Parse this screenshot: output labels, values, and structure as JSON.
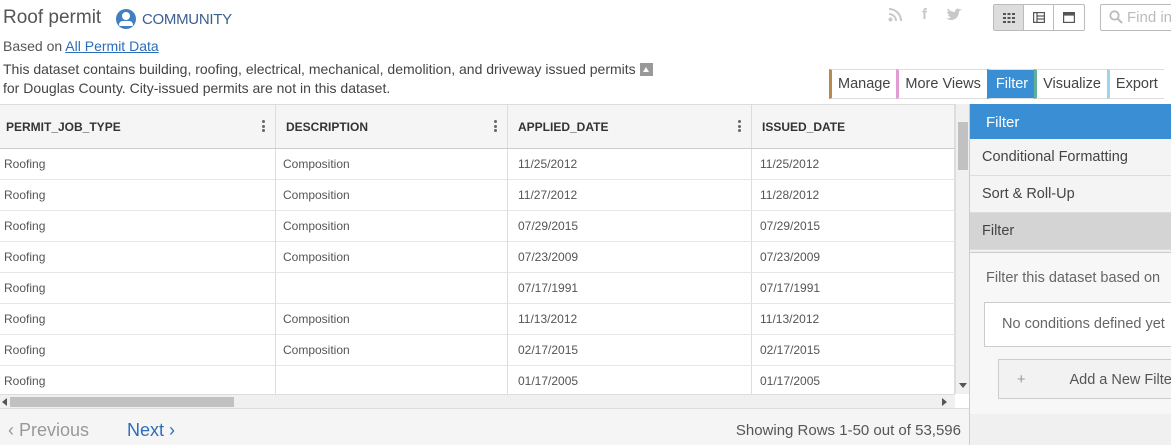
{
  "header": {
    "title": "Roof permit",
    "badge": "COMMUNITY",
    "based_on_prefix": "Based on",
    "based_on_link": "All Permit Data",
    "description": "This dataset contains building, roofing, electrical, mechanical, demolition, and driveway issued permits for Douglas County. City-issued permits are not in this dataset.",
    "search_placeholder": "Find in"
  },
  "social": {
    "rss": "☷",
    "facebook": "f",
    "twitter": "❧"
  },
  "action_tabs": {
    "manage": "Manage",
    "more_views": "More Views",
    "filter": "Filter",
    "visualize": "Visualize",
    "export": "Export"
  },
  "table": {
    "columns": [
      "PERMIT_JOB_TYPE",
      "DESCRIPTION",
      "APPLIED_DATE",
      "ISSUED_DATE"
    ],
    "rows": [
      [
        "Roofing",
        "Composition",
        "11/25/2012",
        "11/25/2012"
      ],
      [
        "Roofing",
        "Composition",
        "11/27/2012",
        "11/28/2012"
      ],
      [
        "Roofing",
        "Composition",
        "07/29/2015",
        "07/29/2015"
      ],
      [
        "Roofing",
        "Composition",
        "07/23/2009",
        "07/23/2009"
      ],
      [
        "Roofing",
        "",
        "07/17/1991",
        "07/17/1991"
      ],
      [
        "Roofing",
        "Composition",
        "11/13/2012",
        "11/13/2012"
      ],
      [
        "Roofing",
        "Composition",
        "02/17/2015",
        "02/17/2015"
      ],
      [
        "Roofing",
        "",
        "01/17/2005",
        "01/17/2005"
      ]
    ]
  },
  "footer": {
    "previous": "Previous",
    "next": "Next",
    "showing": "Showing Rows 1-50 out of 53,596"
  },
  "sidebar": {
    "header": "Filter",
    "items": [
      "Conditional Formatting",
      "Sort & Roll-Up",
      "Filter"
    ],
    "intro": "Filter this dataset based on",
    "no_conditions": "No conditions defined yet",
    "add_button": "Add a New Filter"
  }
}
